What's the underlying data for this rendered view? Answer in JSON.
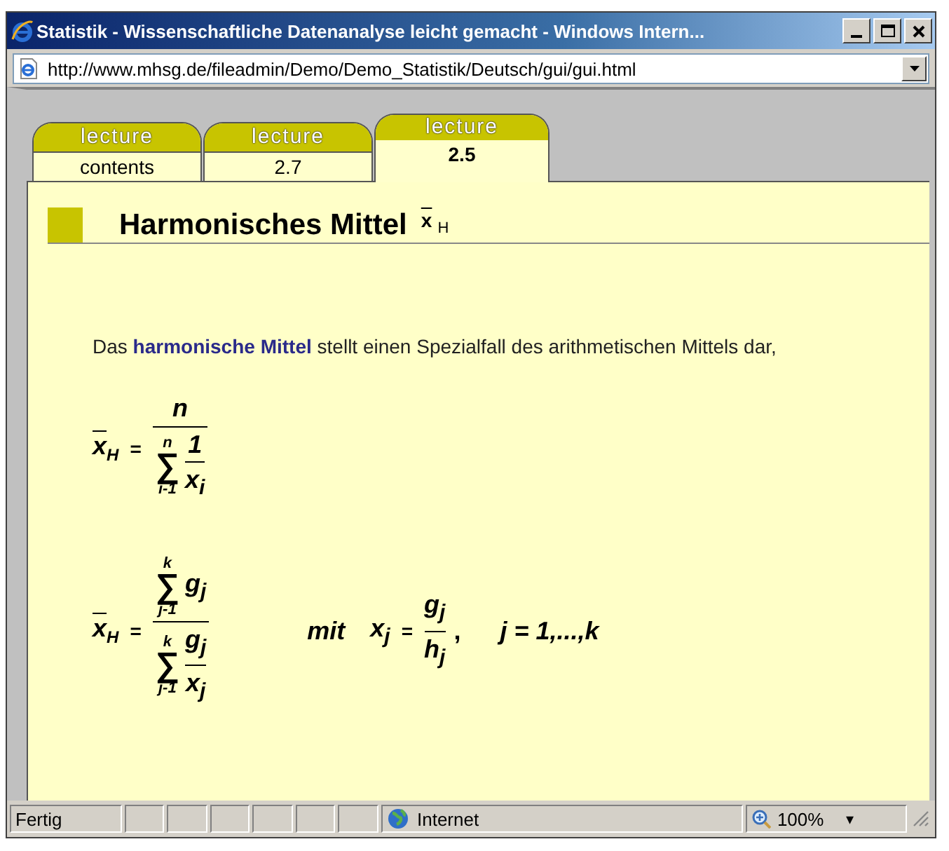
{
  "window": {
    "title": "Statistik - Wissenschaftliche Datenanalyse leicht gemacht - Windows Intern..."
  },
  "address_bar": {
    "url": "http://www.mhsg.de/fileadmin/Demo/Demo_Statistik/Deutsch/gui/gui.html"
  },
  "tabs": [
    {
      "label": "lecture",
      "sublabel": "contents",
      "selected": false
    },
    {
      "label": "lecture",
      "sublabel": "2.7",
      "selected": false
    },
    {
      "label": "lecture",
      "sublabel": "2.5",
      "selected": true
    }
  ],
  "heading": {
    "title": "Harmonisches Mittel",
    "symbol": {
      "base": "x",
      "sub": "H"
    }
  },
  "paragraph": "Das **harmonische Mittel** stellt einen Spezialfall des arithmetischen Mittels dar,",
  "formulas": [
    {
      "lhs": {
        "base": "x",
        "sub": "H"
      },
      "eq": "=",
      "numerator": {
        "text": "n"
      },
      "denominator": {
        "sum": {
          "upper": "n",
          "symbol": "∑",
          "lower": "i-1"
        },
        "frac": {
          "num": "1",
          "den": "x$_{i}$"
        }
      }
    },
    {
      "lhs": {
        "base": "x",
        "sub": "H"
      },
      "eq": "=",
      "numerator": {
        "sum": {
          "upper": "k",
          "symbol": "∑",
          "lower": "j-1"
        },
        "text": "g$_{j}$"
      },
      "denominator": {
        "sum": {
          "upper": "k",
          "symbol": "∑",
          "lower": "j-1"
        },
        "frac": {
          "num": "g$_{j}$",
          "den": "x$_{j}$"
        }
      },
      "condition": {
        "word": "mit",
        "lhs": "x$_{j}$",
        "eq": "=",
        "frac": {
          "num": "g$_{j}$",
          "den": "h$_{j}$"
        },
        "sep": ",",
        "range": "j = 1,...,k"
      }
    }
  ],
  "status_bar": {
    "status": "Fertig",
    "zone": "Internet",
    "zoom": "100%",
    "zoom_caret": "▾"
  }
}
